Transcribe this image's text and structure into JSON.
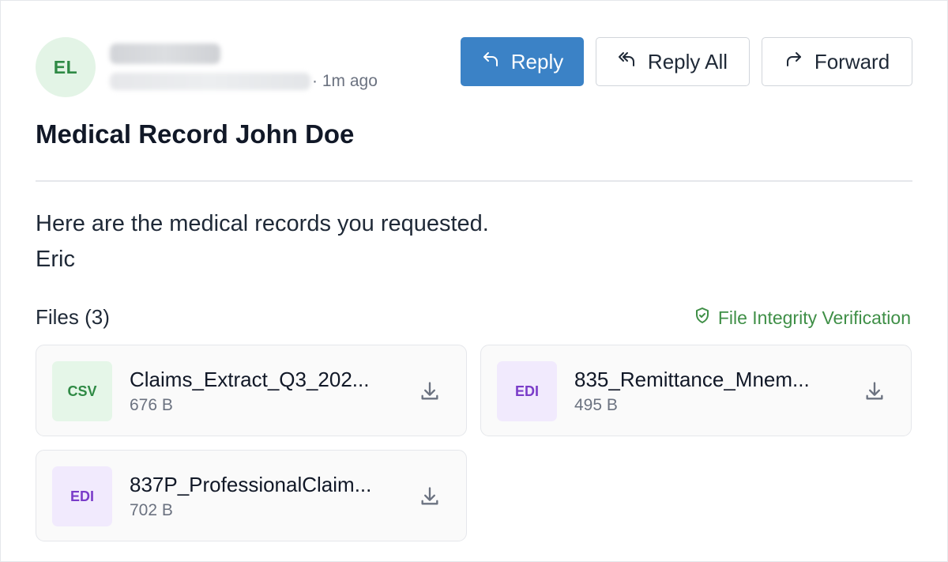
{
  "sender": {
    "initials": "EL",
    "time": "· 1m ago"
  },
  "actions": {
    "reply": "Reply",
    "reply_all": "Reply All",
    "forward": "Forward"
  },
  "email": {
    "subject": "Medical Record John Doe",
    "body_lines": [
      "Here are the medical records you requested.",
      "Eric"
    ]
  },
  "files": {
    "label": "Files (3)",
    "integrity_label": "File Integrity Verification",
    "items": [
      {
        "type": "CSV",
        "name": "Claims_Extract_Q3_202...",
        "size": "676 B"
      },
      {
        "type": "EDI",
        "name": "835_Remittance_Mnem...",
        "size": "495 B"
      },
      {
        "type": "EDI",
        "name": "837P_ProfessionalClaim...",
        "size": "702 B"
      }
    ]
  },
  "icons": {
    "reply": "reply-arrow-icon",
    "reply_all": "reply-all-arrow-icon",
    "forward": "forward-arrow-icon",
    "integrity": "shield-check-icon",
    "download": "download-icon"
  },
  "colors": {
    "primary": "#3b82c6",
    "avatar_bg": "#e3f4e6",
    "avatar_text": "#2f8a45",
    "integrity": "#3f8f47",
    "csv_badge": "#e5f6e8",
    "edi_badge": "#f1eafd",
    "edi_text": "#7a3cc9"
  }
}
